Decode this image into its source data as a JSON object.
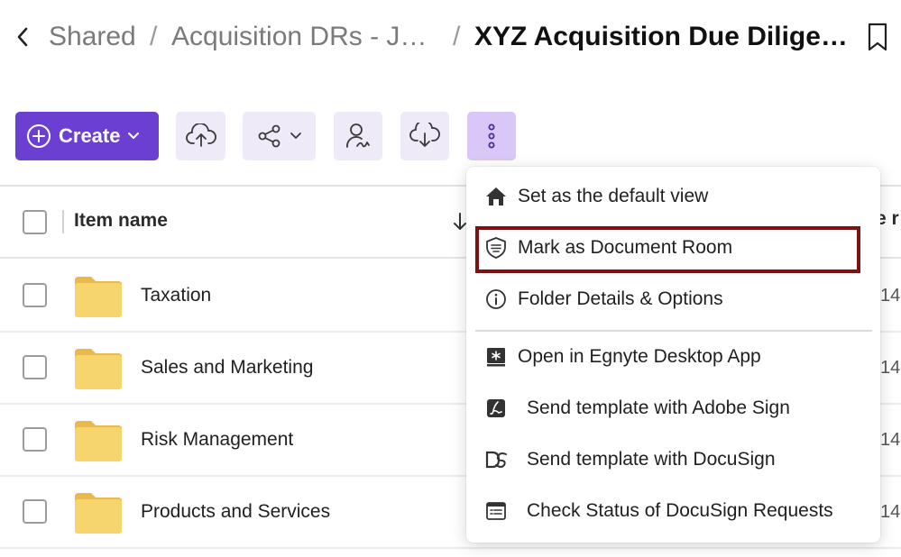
{
  "breadcrumb": {
    "back_glyph": "‹",
    "items": [
      "Shared",
      "Acquisition DRs - J…",
      "XYZ Acquisition Due Dilige…"
    ],
    "separator": "/"
  },
  "toolbar": {
    "create_label": "Create",
    "accent_color": "#6a3fd1",
    "icons": [
      "upload-icon",
      "share-icon",
      "user-signature-icon",
      "download-icon",
      "more-vertical-icon"
    ]
  },
  "table": {
    "header": {
      "item_name": "Item name",
      "edge_label": "e r"
    },
    "rows": [
      {
        "name": "Taxation",
        "edge": "14"
      },
      {
        "name": "Sales and Marketing",
        "edge": "14"
      },
      {
        "name": "Risk Management",
        "edge": "14"
      },
      {
        "name": "Products and Services",
        "edge": "14"
      }
    ]
  },
  "menu": {
    "items": [
      {
        "label": "Set as the default view",
        "icon": "home-icon"
      },
      {
        "label": "Mark as Document Room",
        "icon": "shield-icon",
        "highlighted": true
      },
      {
        "label": "Folder Details & Options",
        "icon": "info-icon"
      },
      {
        "label": "Open in Egnyte Desktop App",
        "icon": "egnyte-desktop-icon"
      },
      {
        "label": "Send template with Adobe Sign",
        "icon": "adobe-sign-icon"
      },
      {
        "label": "Send template with DocuSign",
        "icon": "docusign-icon"
      },
      {
        "label": "Check Status of DocuSign Requests",
        "icon": "list-status-icon"
      }
    ]
  }
}
